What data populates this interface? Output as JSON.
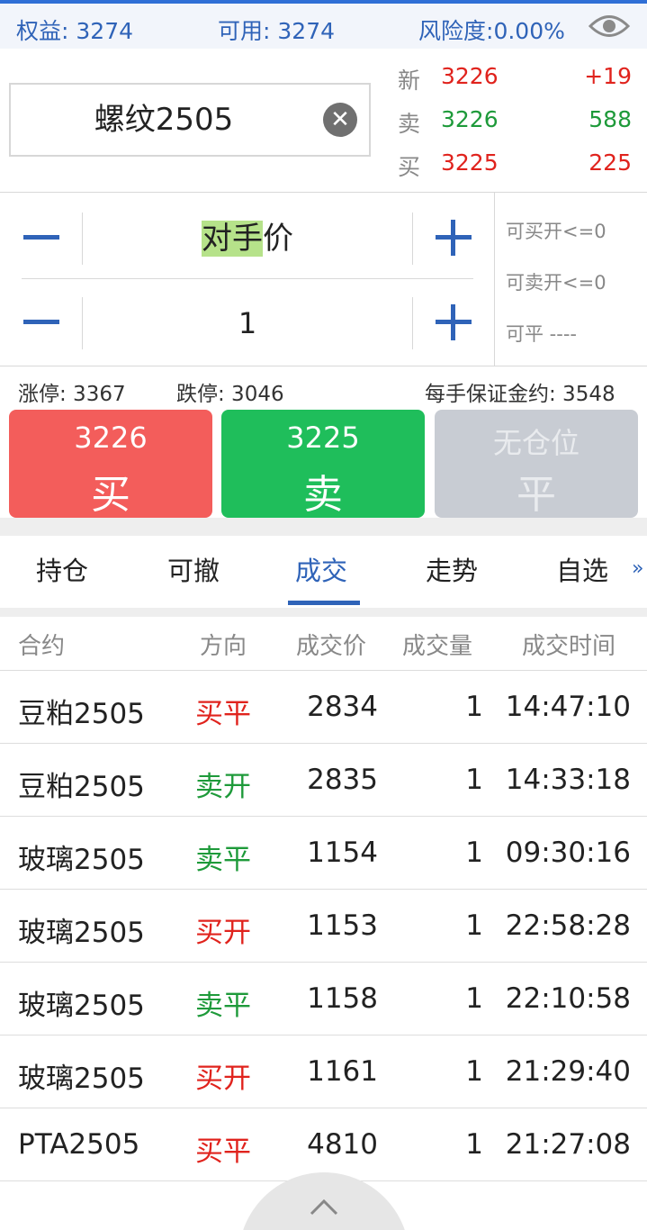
{
  "account": {
    "equity_label": "权益:",
    "equity_value": "3274",
    "available_label": "可用:",
    "available_value": "3274",
    "risk_label": "风险度:",
    "risk_value": "0.00%",
    "eye_icon": "eye-icon"
  },
  "contract": {
    "name": "螺纹2505",
    "clear_icon": "close-circle-icon"
  },
  "quote": {
    "last": {
      "label": "新",
      "price": "3226",
      "value": "+19"
    },
    "ask": {
      "label": "卖",
      "price": "3226",
      "value": "588"
    },
    "bid": {
      "label": "买",
      "price": "3225",
      "value": "225"
    }
  },
  "order": {
    "price_type_hl": "对手",
    "price_type_rest": "价",
    "quantity": "1",
    "can_buy_open": "可买开<=0",
    "can_sell_open": "可卖开<=0",
    "can_close": "可平 ----"
  },
  "limits": {
    "limit_up": "涨停: 3367",
    "limit_down": "跌停: 3046",
    "margin": "每手保证金约: 3548"
  },
  "buttons": {
    "buy": {
      "price": "3226",
      "action": "买"
    },
    "sell": {
      "price": "3225",
      "action": "卖"
    },
    "close": {
      "price": "无仓位",
      "action": "平"
    }
  },
  "colors": {
    "buy": "#f35d5b",
    "sell": "#1fbe5b",
    "close_disabled": "#c8ccd3",
    "accent": "#2f63b8"
  },
  "tabs": [
    {
      "label": "持仓"
    },
    {
      "label": "可撤"
    },
    {
      "label": "成交"
    },
    {
      "label": "走势"
    },
    {
      "label": "自选"
    }
  ],
  "active_tab": "成交",
  "more_icon": "»",
  "table": {
    "headers": [
      "合约",
      "方向",
      "成交价",
      "成交量",
      "成交时间"
    ],
    "rows": [
      {
        "name": "豆粕2505",
        "direction": "买平",
        "dir_color": "red",
        "price": "2834",
        "volume": "1",
        "time": "14:47:10"
      },
      {
        "name": "豆粕2505",
        "direction": "卖开",
        "dir_color": "green",
        "price": "2835",
        "volume": "1",
        "time": "14:33:18"
      },
      {
        "name": "玻璃2505",
        "direction": "卖平",
        "dir_color": "green",
        "price": "1154",
        "volume": "1",
        "time": "09:30:16"
      },
      {
        "name": "玻璃2505",
        "direction": "买开",
        "dir_color": "red",
        "price": "1153",
        "volume": "1",
        "time": "22:58:28"
      },
      {
        "name": "玻璃2505",
        "direction": "卖平",
        "dir_color": "green",
        "price": "1158",
        "volume": "1",
        "time": "22:10:58"
      },
      {
        "name": "玻璃2505",
        "direction": "买开",
        "dir_color": "red",
        "price": "1161",
        "volume": "1",
        "time": "21:29:40"
      },
      {
        "name": "PTA2505",
        "direction": "买平",
        "dir_color": "red",
        "price": "4810",
        "volume": "1",
        "time": "21:27:08"
      }
    ]
  }
}
